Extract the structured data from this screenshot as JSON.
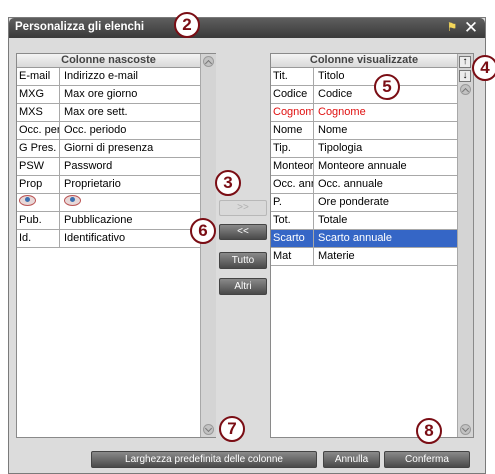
{
  "window": {
    "title": "Personalizza gli elenchi"
  },
  "hidden": {
    "header": "Colonne nascoste",
    "rows": [
      {
        "code": "E-mail",
        "label": "Indirizzo e-mail"
      },
      {
        "code": "MXG",
        "label": "Max ore giorno"
      },
      {
        "code": "MXS",
        "label": "Max ore sett."
      },
      {
        "code": "Occ. per",
        "label": "Occ. periodo"
      },
      {
        "code": "G Pres.",
        "label": "Giorni di presenza"
      },
      {
        "code": "PSW",
        "label": "Password"
      },
      {
        "code": "Prop",
        "label": "Proprietario"
      },
      {
        "code": "",
        "label": "",
        "icon": "eye-icon"
      },
      {
        "code": "Pub.",
        "label": "Pubblicazione"
      },
      {
        "code": "Id.",
        "label": "Identificativo"
      }
    ]
  },
  "shown": {
    "header": "Colonne visualizzate",
    "rows": [
      {
        "code": "Tit.",
        "label": "Titolo"
      },
      {
        "code": "Codice",
        "label": "Codice"
      },
      {
        "code": "Cognome",
        "label": "Cognome",
        "color": "#e01010"
      },
      {
        "code": "Nome",
        "label": "Nome"
      },
      {
        "code": "Tip.",
        "label": "Tipologia"
      },
      {
        "code": "Monteore",
        "label": "Monteore annuale"
      },
      {
        "code": "Occ. anr",
        "label": "Occ. annuale"
      },
      {
        "code": "P.",
        "label": "Ore ponderate"
      },
      {
        "code": "Tot.",
        "label": "Totale"
      },
      {
        "code": "Scarto",
        "label": "Scarto annuale",
        "selected": true
      },
      {
        "code": "Mat",
        "label": "Materie"
      }
    ]
  },
  "buttons": {
    "move_right": ">>",
    "move_left": "<<",
    "all": "Tutto",
    "others": "Altri",
    "default_width": "Larghezza predefinita delle colonne",
    "cancel": "Annulla",
    "confirm": "Conferma"
  },
  "order_buttons": {
    "up": "↑",
    "down": "↓"
  },
  "callouts": [
    "2",
    "3",
    "4",
    "5",
    "6",
    "7",
    "8"
  ],
  "colors": {
    "selected": "#3566c6",
    "highlight_text": "#e01010",
    "callout": "#7a0d14"
  }
}
